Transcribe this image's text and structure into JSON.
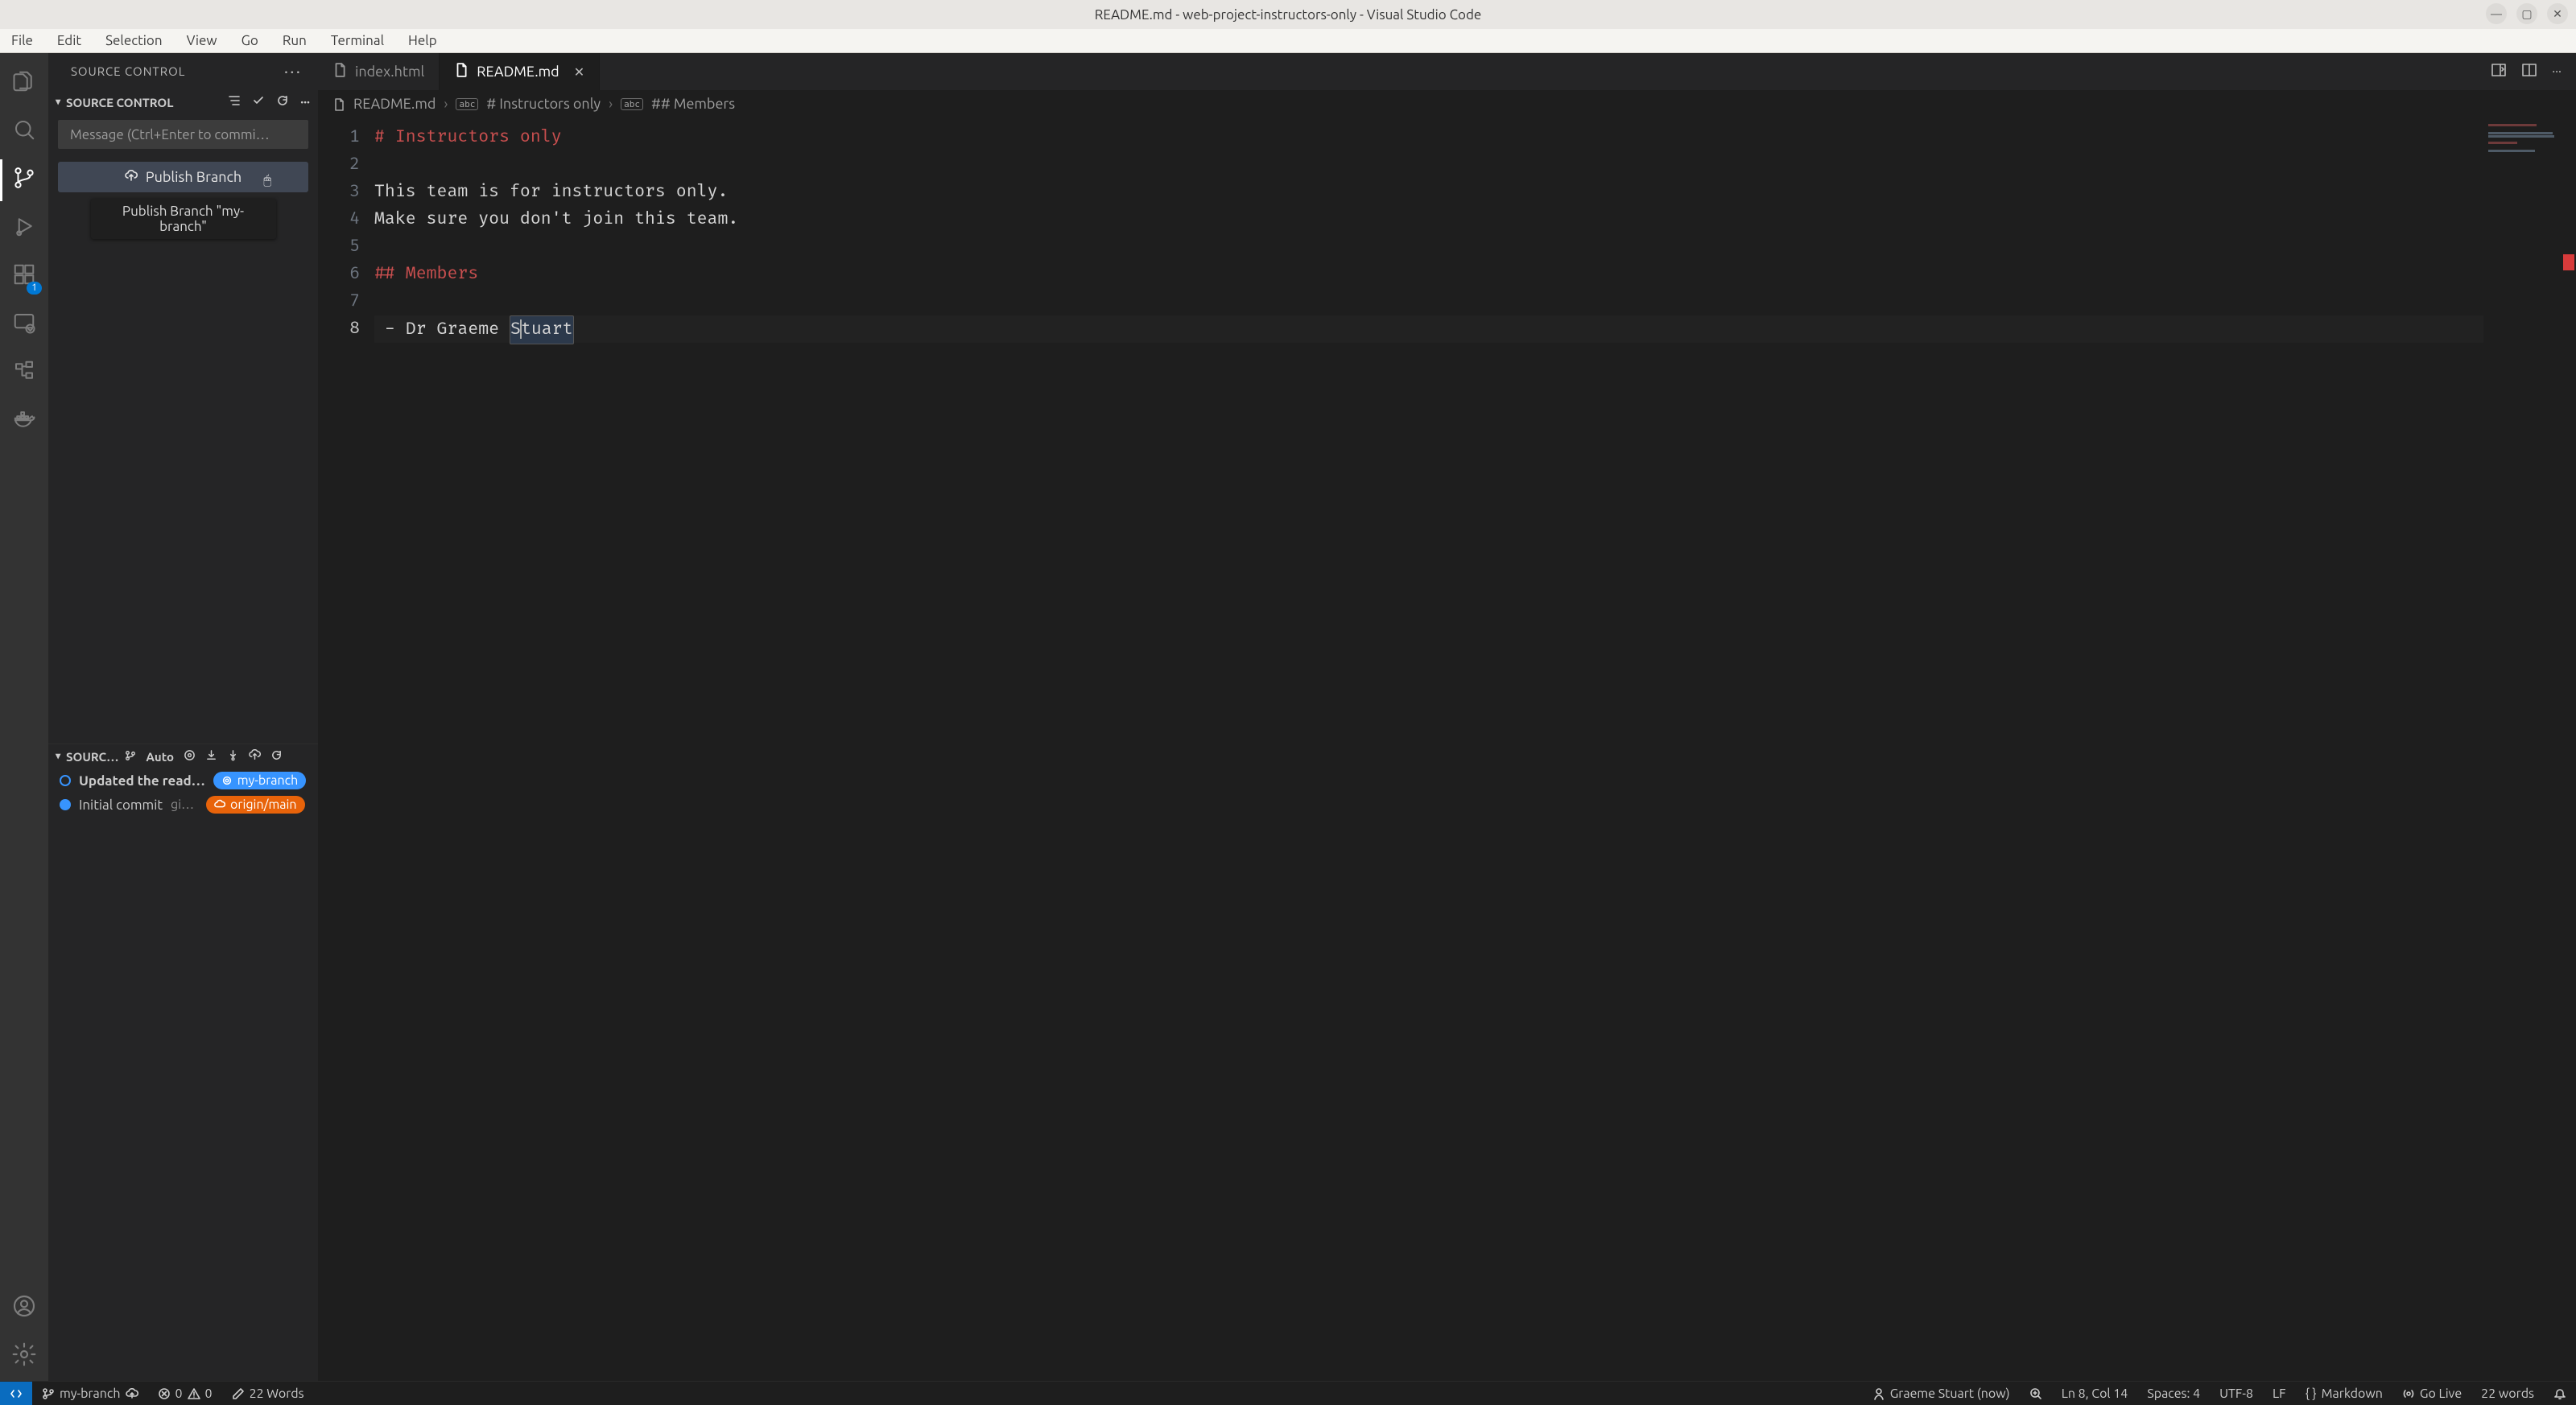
{
  "window": {
    "title": "README.md - web-project-instructors-only - Visual Studio Code"
  },
  "menubar": [
    "File",
    "Edit",
    "Selection",
    "View",
    "Go",
    "Run",
    "Terminal",
    "Help"
  ],
  "activitybar": {
    "extensions_badge": "1"
  },
  "sidebar": {
    "title": "SOURCE CONTROL",
    "section_label": "SOURCE CONTROL",
    "commit_placeholder": "Message (Ctrl+Enter to commi…",
    "publish_label": "Publish Branch",
    "tooltip": "Publish Branch \"my-branch\"",
    "graph": {
      "label": "SOURC…",
      "auto": "Auto",
      "commits": [
        {
          "message": "Updated the read…",
          "branch": "my-branch",
          "chip_kind": "blue",
          "dot": "hollow",
          "meta": ""
        },
        {
          "message": "Initial commit",
          "branch": "origin/main",
          "chip_kind": "orange",
          "dot": "filled",
          "meta": "git…"
        }
      ]
    }
  },
  "tabs": [
    {
      "name": "index.html",
      "active": false
    },
    {
      "name": "README.md",
      "active": true
    }
  ],
  "breadcrumbs": {
    "file": "README.md",
    "h1": "# Instructors only",
    "h2": "## Members"
  },
  "editor": {
    "lines": [
      {
        "n": 1,
        "kind": "h1",
        "prefix": "# ",
        "text": "Instructors only"
      },
      {
        "n": 2,
        "kind": "blank",
        "text": ""
      },
      {
        "n": 3,
        "kind": "text",
        "text": "This team is for instructors only."
      },
      {
        "n": 4,
        "kind": "text",
        "text": "Make sure you don't join this team."
      },
      {
        "n": 5,
        "kind": "blank",
        "text": ""
      },
      {
        "n": 6,
        "kind": "h2",
        "prefix": "## ",
        "text": "Members"
      },
      {
        "n": 7,
        "kind": "blank",
        "text": ""
      },
      {
        "n": 8,
        "kind": "list",
        "text": " - Dr Graeme ",
        "sel": "Stuart",
        "caret_after_first_char": true
      }
    ],
    "current_line": 8
  },
  "statusbar": {
    "branch": "my-branch",
    "errors": "0",
    "warnings": "0",
    "words_left": "22 Words",
    "blame": "Graeme Stuart (now)",
    "cursor": "Ln 8, Col 14",
    "spaces": "Spaces: 4",
    "encoding": "UTF-8",
    "eol": "LF",
    "lang": "Markdown",
    "golive": "Go Live",
    "words_right": "22 words"
  }
}
